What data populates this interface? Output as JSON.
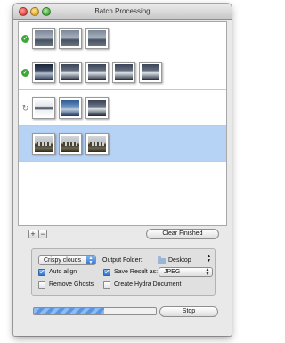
{
  "window": {
    "title": "Batch Processing"
  },
  "batches": [
    {
      "status": "done",
      "status_icon": "checkmark-circle-icon",
      "thumbnails": [
        "t-grey",
        "t-grey",
        "t-grey"
      ]
    },
    {
      "status": "done",
      "status_icon": "checkmark-circle-icon",
      "thumbnails": [
        "t-dark",
        "t-slate",
        "t-slate",
        "t-slate",
        "t-slate"
      ]
    },
    {
      "status": "processing",
      "status_icon": "spinner-icon",
      "thumbnails": [
        "t-pale",
        "t-blue",
        "t-slate"
      ]
    },
    {
      "status": "queued",
      "selected": true,
      "thumbnails": [
        "t-arch",
        "t-arch",
        "t-arch"
      ]
    }
  ],
  "list_controls": {
    "add_label": "+",
    "remove_label": "−",
    "clear_label": "Clear Finished"
  },
  "settings": {
    "preset": "Crispy clouds",
    "auto_align": {
      "label": "Auto align",
      "checked": true
    },
    "remove_ghosts": {
      "label": "Remove Ghosts",
      "checked": false
    },
    "output_folder_label": "Output Folder:",
    "output_folder": "Desktop",
    "save_result": {
      "label": "Save Result as:",
      "checked": true
    },
    "save_format": "JPEG",
    "create_hydra": {
      "label": "Create Hydra Document",
      "checked": false
    }
  },
  "progress": {
    "fraction": 0.58
  },
  "stop_label": "Stop",
  "colors": {
    "selected_row": "#b6d2f5",
    "check_green": "#3ea63a",
    "accent_blue": "#2f74d0"
  }
}
